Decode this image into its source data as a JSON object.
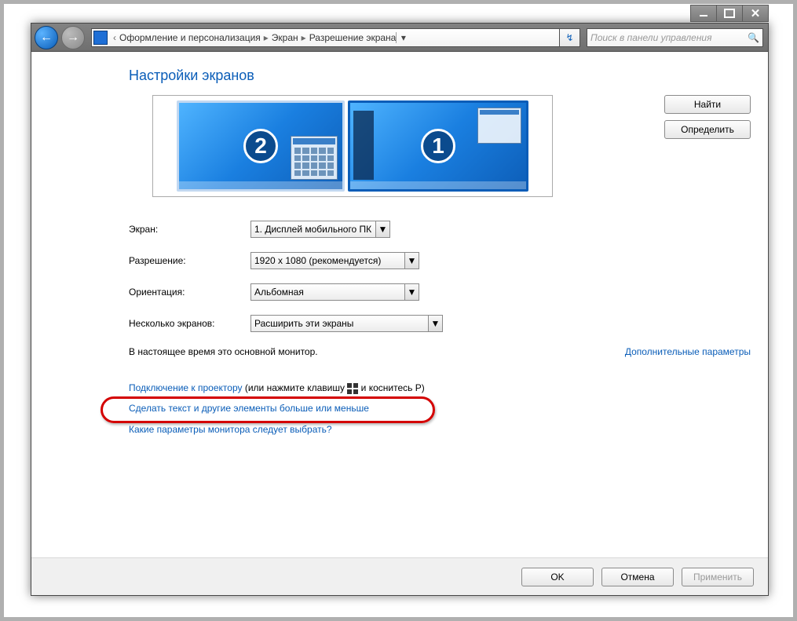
{
  "breadcrumb": {
    "p1": "Оформление и персонализация",
    "p2": "Экран",
    "p3": "Разрешение экрана"
  },
  "search": {
    "placeholder": "Поиск в панели управления"
  },
  "heading": "Настройки экранов",
  "buttons": {
    "detect": "Найти",
    "identify": "Определить",
    "ok": "OK",
    "cancel": "Отмена",
    "apply": "Применить"
  },
  "monitors": {
    "m1": "1",
    "m2": "2"
  },
  "labels": {
    "display": "Экран:",
    "resolution": "Разрешение:",
    "orientation": "Ориентация:",
    "multi": "Несколько экранов:"
  },
  "values": {
    "display": "1. Дисплей мобильного ПК",
    "resolution": "1920 x 1080 (рекомендуется)",
    "orientation": "Альбомная",
    "multi": "Расширить эти экраны"
  },
  "primary_note": "В настоящее время это основной монитор.",
  "adv_link": "Дополнительные параметры",
  "projector": {
    "link": "Подключение к проектору",
    "t1": " (или нажмите клавишу ",
    "t2": " и коснитесь Р)"
  },
  "resize_link": "Сделать текст и другие элементы больше или меньше",
  "which_link": "Какие параметры монитора следует выбрать?"
}
